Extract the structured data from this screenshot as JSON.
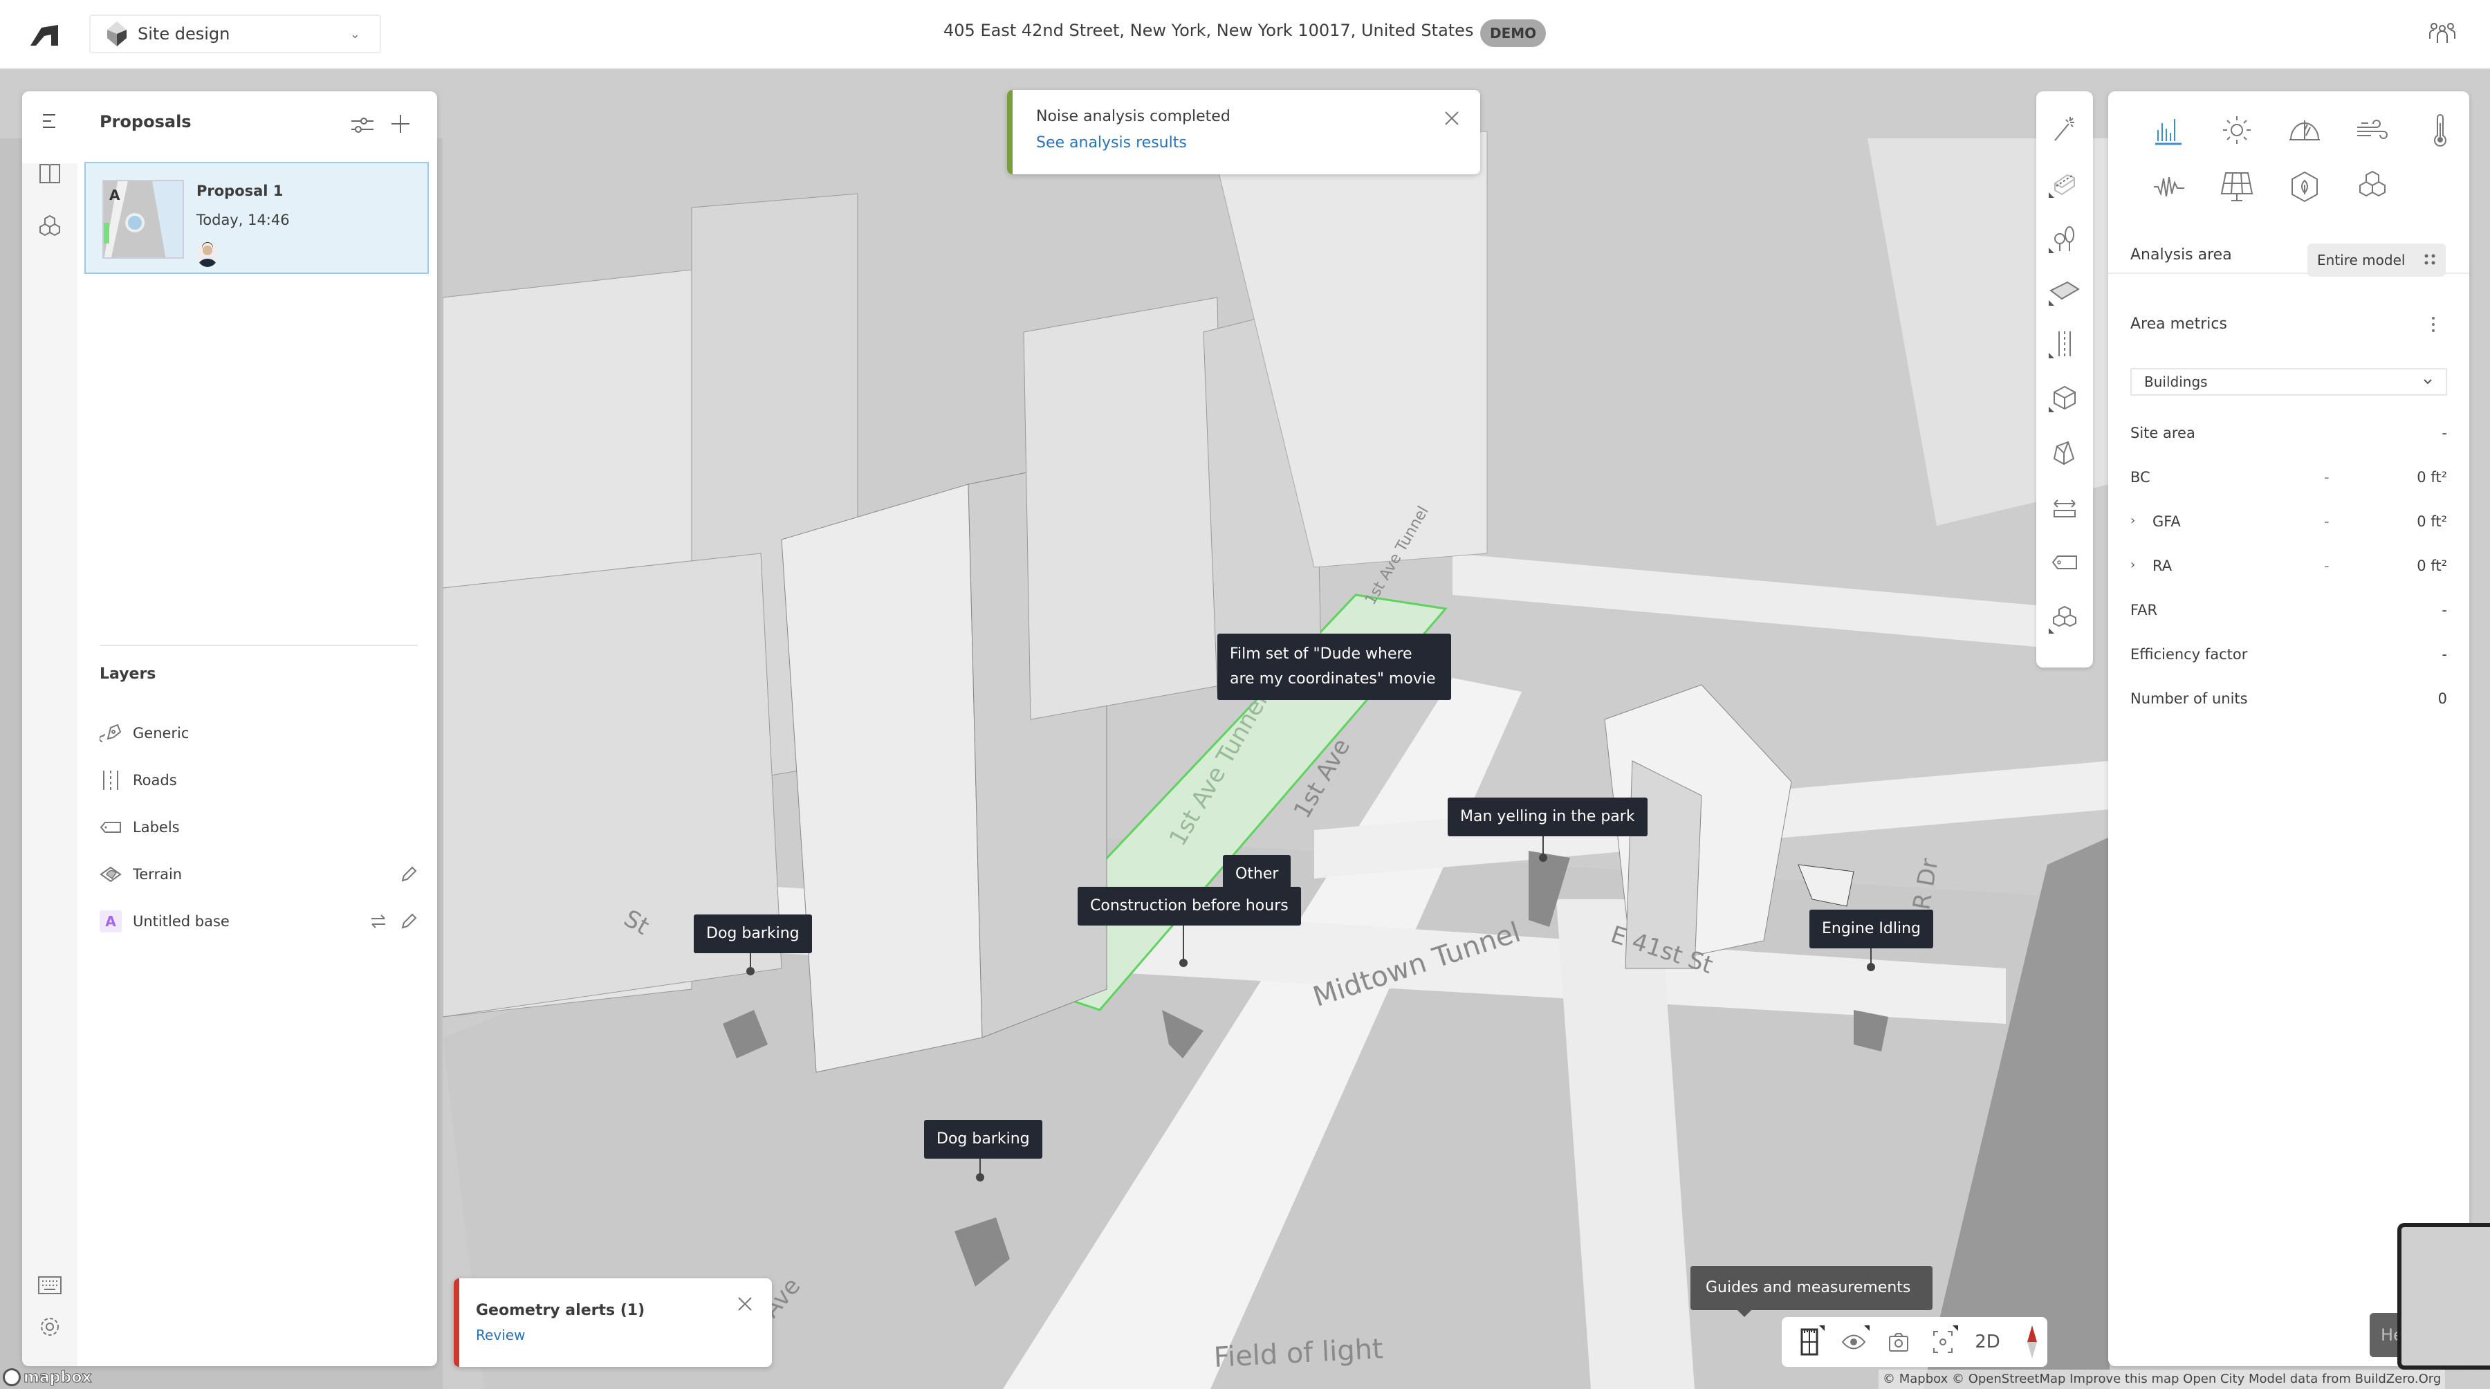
{
  "header": {
    "project_selector": {
      "label": "Site design",
      "icon": "site-design-diamond-icon"
    },
    "address": "405 East 42nd Street, New York, New York 10017, United States",
    "address_lock_icon": "unlock-icon",
    "badge": "DEMO",
    "collaborators_icon": "people-icon"
  },
  "left_panel": {
    "rail_icons": [
      "menu-icon",
      "book-icon",
      "cubes-icon",
      "keyboard-icon",
      "gear-icon"
    ],
    "proposals": {
      "title": "Proposals",
      "filter_icon": "sliders-icon",
      "add_icon": "plus-icon",
      "items": [
        {
          "thumb_letter": "A",
          "name": "Proposal 1",
          "time": "Today, 14:46",
          "selected": true
        }
      ]
    },
    "layers": {
      "title": "Layers",
      "items": [
        {
          "name": "Generic",
          "icon": "generic-layer-icon",
          "actions": []
        },
        {
          "name": "Roads",
          "icon": "roads-icon",
          "actions": []
        },
        {
          "name": "Labels",
          "icon": "tag-icon",
          "actions": []
        },
        {
          "name": "Terrain",
          "icon": "terrain-icon",
          "actions": [
            "edit"
          ]
        },
        {
          "name": "Untitled base",
          "icon": "base-letter",
          "badge": "A",
          "actions": [
            "swap",
            "edit"
          ]
        }
      ]
    }
  },
  "notifications": {
    "noise": {
      "title": "Noise analysis completed",
      "link": "See analysis results",
      "accent": "#7a9e3c"
    },
    "geometry": {
      "title": "Geometry alerts (1)",
      "link": "Review",
      "accent": "#d0382e"
    }
  },
  "map": {
    "markers": [
      {
        "label": "Film set of \"Dude where are my coordinates\" movie"
      },
      {
        "label": "Man yelling in the park"
      },
      {
        "label": "Other"
      },
      {
        "label": "Construction before hours"
      },
      {
        "label": "Dog barking"
      },
      {
        "label": "Engine Idling"
      },
      {
        "label": "Dog barking"
      }
    ],
    "street_labels": [
      "1st Ave Tunnel",
      "1st Ave",
      "1st Ave Tunnel",
      "Midtown Tunnel",
      "E 41st St",
      "FDR Dr",
      "Field of light",
      "St",
      "Ave"
    ],
    "highlight_color": "#5fd35f"
  },
  "tool_strip": {
    "tools": [
      "magic-wand-icon",
      "building-extrude-icon",
      "trees-icon",
      "zone-hatch-icon",
      "roads-tool-icon",
      "box-icon",
      "tapered-box-icon",
      "measure-icon",
      "label-tag-icon",
      "cubes-group-icon"
    ]
  },
  "right_panel": {
    "analysis_icons": [
      "bar-chart-icon",
      "sun-icon",
      "daylight-dome-icon",
      "wind-icon",
      "thermometer-icon",
      "noise-wave-icon",
      "solar-panel-icon",
      "carbon-leaf-icon",
      "cubes-icon"
    ],
    "active_analysis": "bar-chart-icon",
    "accent": "#3b8ed0",
    "analysis_area": {
      "label": "Analysis area",
      "value": "Entire model"
    },
    "area_metrics": {
      "title": "Area metrics",
      "filter": "Buildings",
      "rows": [
        {
          "label": "Site area",
          "mid": "",
          "value": "-",
          "expandable": false
        },
        {
          "label": "BC",
          "mid": "-",
          "value": "0 ft²",
          "expandable": false
        },
        {
          "label": "GFA",
          "mid": "-",
          "value": "0 ft²",
          "expandable": true
        },
        {
          "label": "RA",
          "mid": "-",
          "value": "0 ft²",
          "expandable": true
        },
        {
          "label": "FAR",
          "mid": "",
          "value": "-",
          "expandable": false
        },
        {
          "label": "Efficiency factor",
          "mid": "",
          "value": "-",
          "expandable": false
        },
        {
          "label": "Number of units",
          "mid": "",
          "value": "0",
          "expandable": false
        }
      ]
    }
  },
  "bottom_toolbar": {
    "tooltip": "Guides and measurements",
    "buttons": [
      "guides-icon",
      "visibility-eye-icon",
      "camera-icon",
      "focus-icon",
      "2D",
      "compass-icon"
    ],
    "view_mode_label": "2D"
  },
  "help_label": "Help",
  "attribution": "© Mapbox © OpenStreetMap  Improve this map  Open City Model data from BuildZero.Org",
  "mapbox_logo": "mapbox"
}
